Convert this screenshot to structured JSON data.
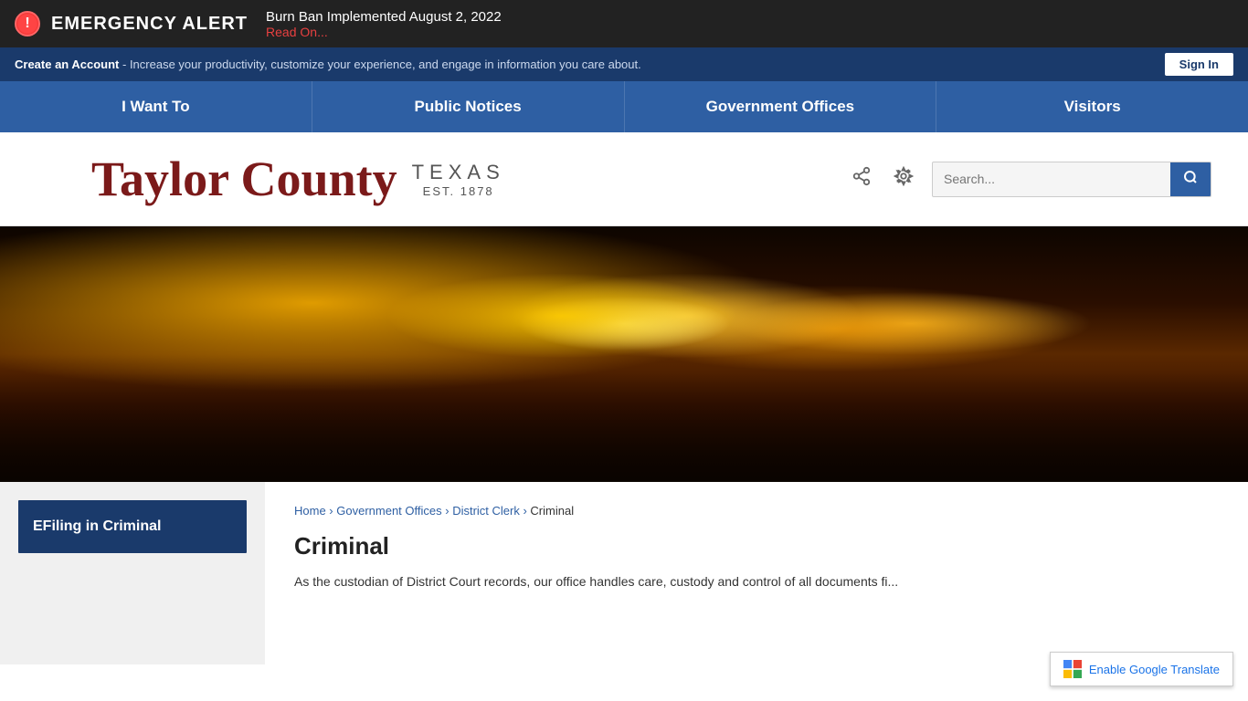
{
  "emergency": {
    "title": "EMERGENCY ALERT",
    "headline": "Burn Ban Implemented August 2, 2022",
    "link_text": "Read On..."
  },
  "account_bar": {
    "create_text": "Create an Account",
    "description": " - Increase your productivity, customize your experience, and engage in information you care about.",
    "sign_in": "Sign In"
  },
  "nav": {
    "items": [
      {
        "label": "I Want To"
      },
      {
        "label": "Public Notices"
      },
      {
        "label": "Government Offices"
      },
      {
        "label": "Visitors"
      }
    ]
  },
  "logo": {
    "main": "Taylor County",
    "texas": "TEXAS",
    "est": "EST. 1878",
    "search_placeholder": "Search..."
  },
  "sidebar": {
    "items": [
      {
        "label": "EFiling in Criminal"
      }
    ]
  },
  "breadcrumb": {
    "home": "Home",
    "gov_offices": "Government Offices",
    "district_clerk": "District Clerk",
    "current": "Criminal"
  },
  "page": {
    "title": "Criminal",
    "description": "As the custodian of District Court records, our office handles care, custody and control of all documents fi..."
  },
  "translate": {
    "label": "Enable Google Translate"
  }
}
